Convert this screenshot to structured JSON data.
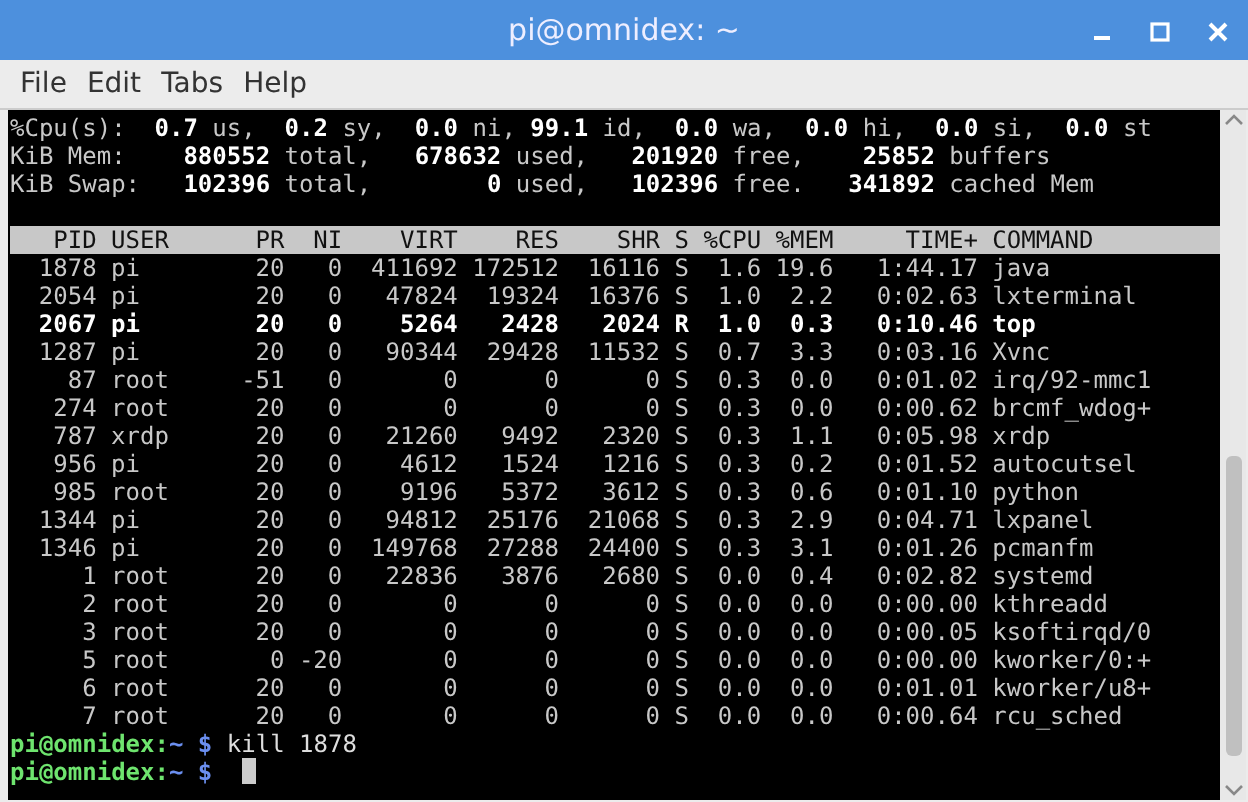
{
  "window": {
    "title": "pi@omnidex: ~"
  },
  "menu": [
    "File",
    "Edit",
    "Tabs",
    "Help"
  ],
  "summary": [
    "%Cpu(s):  **0.7** us,  **0.2** sy,  **0.0** ni, **99.1** id,  **0.0** wa,  **0.0** hi,  **0.0** si,  **0.0** st",
    "KiB Mem:    **880552** total,   **678632** used,   **201920** free,    **25852** buffers",
    "KiB Swap:   **102396** total,        **0** used,   **102396** free.   **341892** cached Mem"
  ],
  "table": {
    "columns": [
      "PID",
      "USER",
      "PR",
      "NI",
      "VIRT",
      "RES",
      "SHR",
      "S",
      "%CPU",
      "%MEM",
      "TIME+",
      "COMMAND"
    ],
    "rows": [
      {
        "highlighted": false,
        "cells": [
          "1878",
          "pi",
          "20",
          "0",
          "411692",
          "172512",
          "16116",
          "S",
          "1.6",
          "19.6",
          "1:44.17",
          "java"
        ]
      },
      {
        "highlighted": false,
        "cells": [
          "2054",
          "pi",
          "20",
          "0",
          "47824",
          "19324",
          "16376",
          "S",
          "1.0",
          "2.2",
          "0:02.63",
          "lxterminal"
        ]
      },
      {
        "highlighted": true,
        "cells": [
          "2067",
          "pi",
          "20",
          "0",
          "5264",
          "2428",
          "2024",
          "R",
          "1.0",
          "0.3",
          "0:10.46",
          "top"
        ]
      },
      {
        "highlighted": false,
        "cells": [
          "1287",
          "pi",
          "20",
          "0",
          "90344",
          "29428",
          "11532",
          "S",
          "0.7",
          "3.3",
          "0:03.16",
          "Xvnc"
        ]
      },
      {
        "highlighted": false,
        "cells": [
          "87",
          "root",
          "-51",
          "0",
          "0",
          "0",
          "0",
          "S",
          "0.3",
          "0.0",
          "0:01.02",
          "irq/92-mmc1"
        ]
      },
      {
        "highlighted": false,
        "cells": [
          "274",
          "root",
          "20",
          "0",
          "0",
          "0",
          "0",
          "S",
          "0.3",
          "0.0",
          "0:00.62",
          "brcmf_wdog+"
        ]
      },
      {
        "highlighted": false,
        "cells": [
          "787",
          "xrdp",
          "20",
          "0",
          "21260",
          "9492",
          "2320",
          "S",
          "0.3",
          "1.1",
          "0:05.98",
          "xrdp"
        ]
      },
      {
        "highlighted": false,
        "cells": [
          "956",
          "pi",
          "20",
          "0",
          "4612",
          "1524",
          "1216",
          "S",
          "0.3",
          "0.2",
          "0:01.52",
          "autocutsel"
        ]
      },
      {
        "highlighted": false,
        "cells": [
          "985",
          "root",
          "20",
          "0",
          "9196",
          "5372",
          "3612",
          "S",
          "0.3",
          "0.6",
          "0:01.10",
          "python"
        ]
      },
      {
        "highlighted": false,
        "cells": [
          "1344",
          "pi",
          "20",
          "0",
          "94812",
          "25176",
          "21068",
          "S",
          "0.3",
          "2.9",
          "0:04.71",
          "lxpanel"
        ]
      },
      {
        "highlighted": false,
        "cells": [
          "1346",
          "pi",
          "20",
          "0",
          "149768",
          "27288",
          "24400",
          "S",
          "0.3",
          "3.1",
          "0:01.26",
          "pcmanfm"
        ]
      },
      {
        "highlighted": false,
        "cells": [
          "1",
          "root",
          "20",
          "0",
          "22836",
          "3876",
          "2680",
          "S",
          "0.0",
          "0.4",
          "0:02.82",
          "systemd"
        ]
      },
      {
        "highlighted": false,
        "cells": [
          "2",
          "root",
          "20",
          "0",
          "0",
          "0",
          "0",
          "S",
          "0.0",
          "0.0",
          "0:00.00",
          "kthreadd"
        ]
      },
      {
        "highlighted": false,
        "cells": [
          "3",
          "root",
          "20",
          "0",
          "0",
          "0",
          "0",
          "S",
          "0.0",
          "0.0",
          "0:00.05",
          "ksoftirqd/0"
        ]
      },
      {
        "highlighted": false,
        "cells": [
          "5",
          "root",
          "0",
          "-20",
          "0",
          "0",
          "0",
          "S",
          "0.0",
          "0.0",
          "0:00.00",
          "kworker/0:+"
        ]
      },
      {
        "highlighted": false,
        "cells": [
          "6",
          "root",
          "20",
          "0",
          "0",
          "0",
          "0",
          "S",
          "0.0",
          "0.0",
          "0:01.01",
          "kworker/u8+"
        ]
      },
      {
        "highlighted": false,
        "cells": [
          "7",
          "root",
          "20",
          "0",
          "0",
          "0",
          "0",
          "S",
          "0.0",
          "0.0",
          "0:00.64",
          "rcu_sched"
        ]
      }
    ]
  },
  "prompts": [
    {
      "host": "pi@omnidex:",
      "path": "~ $",
      "command": "kill 1878",
      "cursor": false
    },
    {
      "host": "pi@omnidex:",
      "path": "~ $",
      "cursor": true
    }
  ]
}
